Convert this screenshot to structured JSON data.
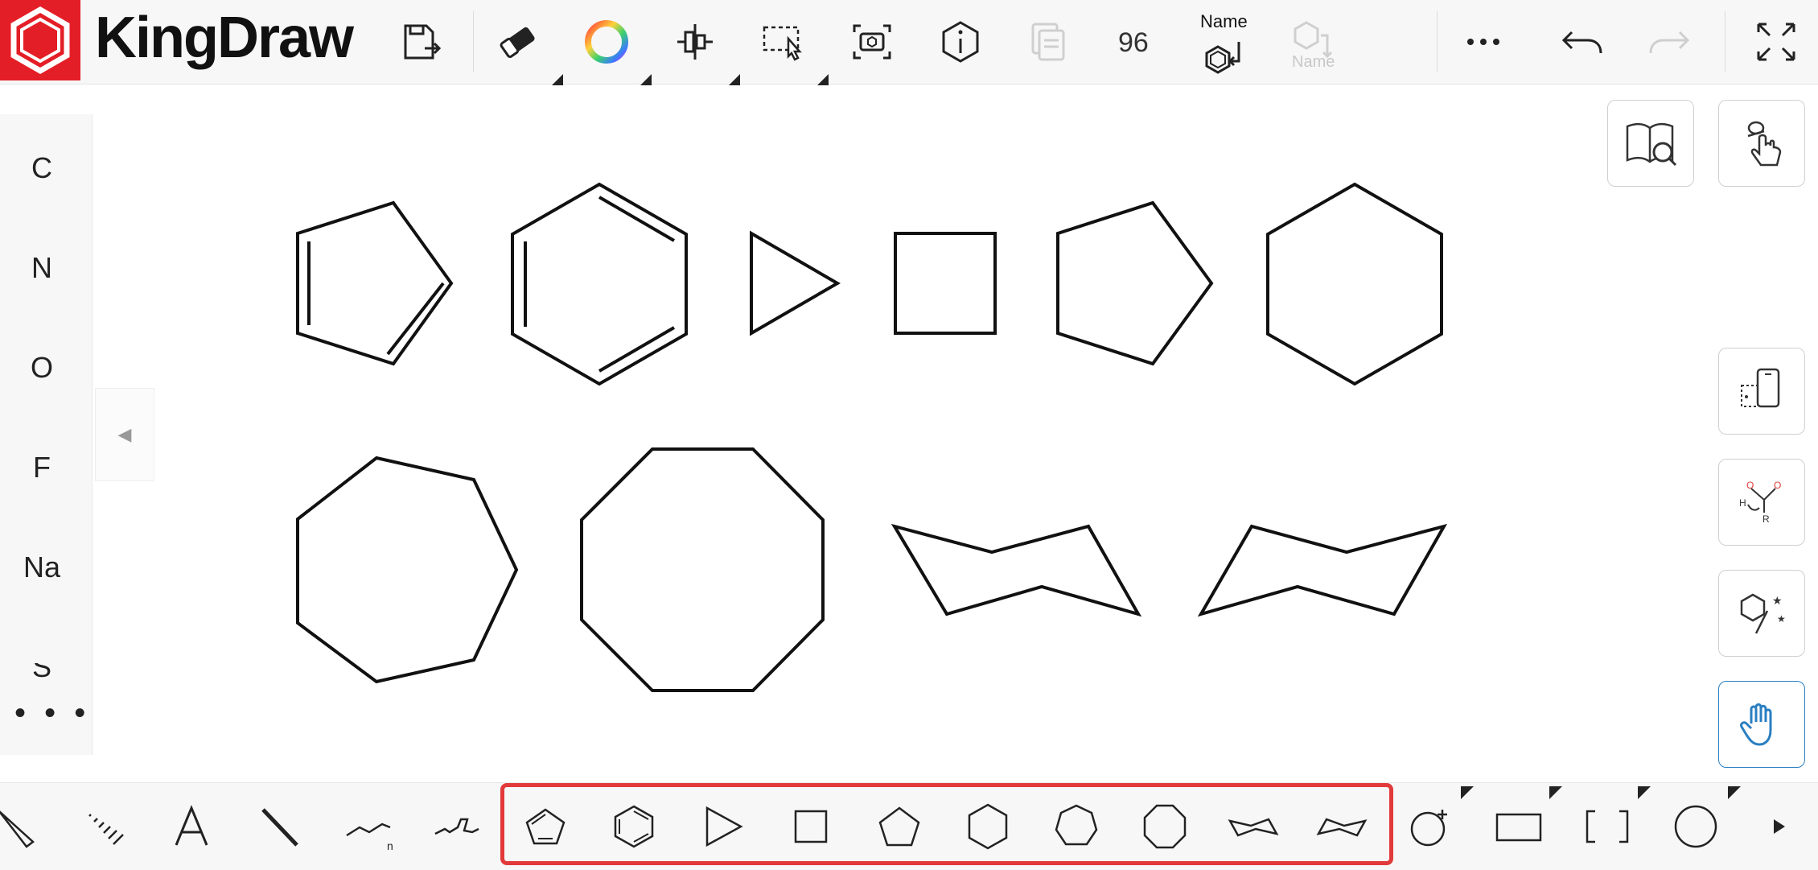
{
  "app": {
    "title": "KingDraw",
    "brand_color": "#e41e26"
  },
  "toolbar": {
    "items": [
      {
        "name": "save-icon",
        "label": ""
      },
      {
        "name": "eraser-icon",
        "label": ""
      },
      {
        "name": "color-wheel-icon",
        "label": ""
      },
      {
        "name": "align-icon",
        "label": ""
      },
      {
        "name": "select-icon",
        "label": ""
      },
      {
        "name": "screenshot-icon",
        "label": ""
      },
      {
        "name": "info-icon",
        "label": ""
      },
      {
        "name": "copy-icon",
        "label": ""
      },
      {
        "name": "zoom-indicator",
        "label": "96"
      },
      {
        "name": "name-structure-icon",
        "label": "Name"
      },
      {
        "name": "name-structure-disabled-icon",
        "label": "Name"
      },
      {
        "name": "more-icon",
        "label": ""
      },
      {
        "name": "undo-icon",
        "label": ""
      },
      {
        "name": "redo-icon",
        "label": ""
      },
      {
        "name": "fullscreen-icon",
        "label": ""
      }
    ],
    "zoom": "96",
    "name_label": "Name",
    "name_label_disabled": "Name"
  },
  "elements_panel": {
    "items": [
      "C",
      "N",
      "O",
      "F",
      "Na",
      "S"
    ],
    "more": "• • •"
  },
  "right_panel": {
    "buttons": [
      {
        "name": "search-library-icon"
      },
      {
        "name": "tap-gesture-icon"
      },
      {
        "name": "device-rotate-icon"
      },
      {
        "name": "reaction-mechanism-icon"
      },
      {
        "name": "stereo-magic-icon"
      },
      {
        "name": "pan-hand-icon",
        "active": true,
        "color": "#2a7fc1"
      }
    ],
    "reaction_labels": {
      "h": "H",
      "r": "R",
      "o1": "O",
      "o2": "O"
    }
  },
  "canvas": {
    "structures": [
      "cyclopentadiene",
      "benzene",
      "cyclopropane",
      "cyclobutane",
      "cyclopentane",
      "cyclohexane",
      "cycloheptane",
      "cyclooctane",
      "cyclohexane-chair-1",
      "cyclohexane-chair-2"
    ]
  },
  "bottom_toolbar": {
    "tools": [
      "wedge-bond",
      "hash-bond",
      "text-tool",
      "single-bond",
      "chain-tool",
      "chain-n-tool"
    ],
    "chain_subscript": "n",
    "rings": [
      "cyclopentadiene-ring",
      "benzene-ring",
      "cyclopropane-ring",
      "cyclobutane-ring",
      "cyclopentane-ring",
      "cyclohexane-ring",
      "cycloheptane-ring",
      "cyclooctane-ring",
      "chair-ring-1",
      "chair-ring-2"
    ],
    "shapes": [
      "add-ring",
      "rectangle",
      "brackets",
      "circle"
    ],
    "highlight_color": "#e23a3a"
  }
}
